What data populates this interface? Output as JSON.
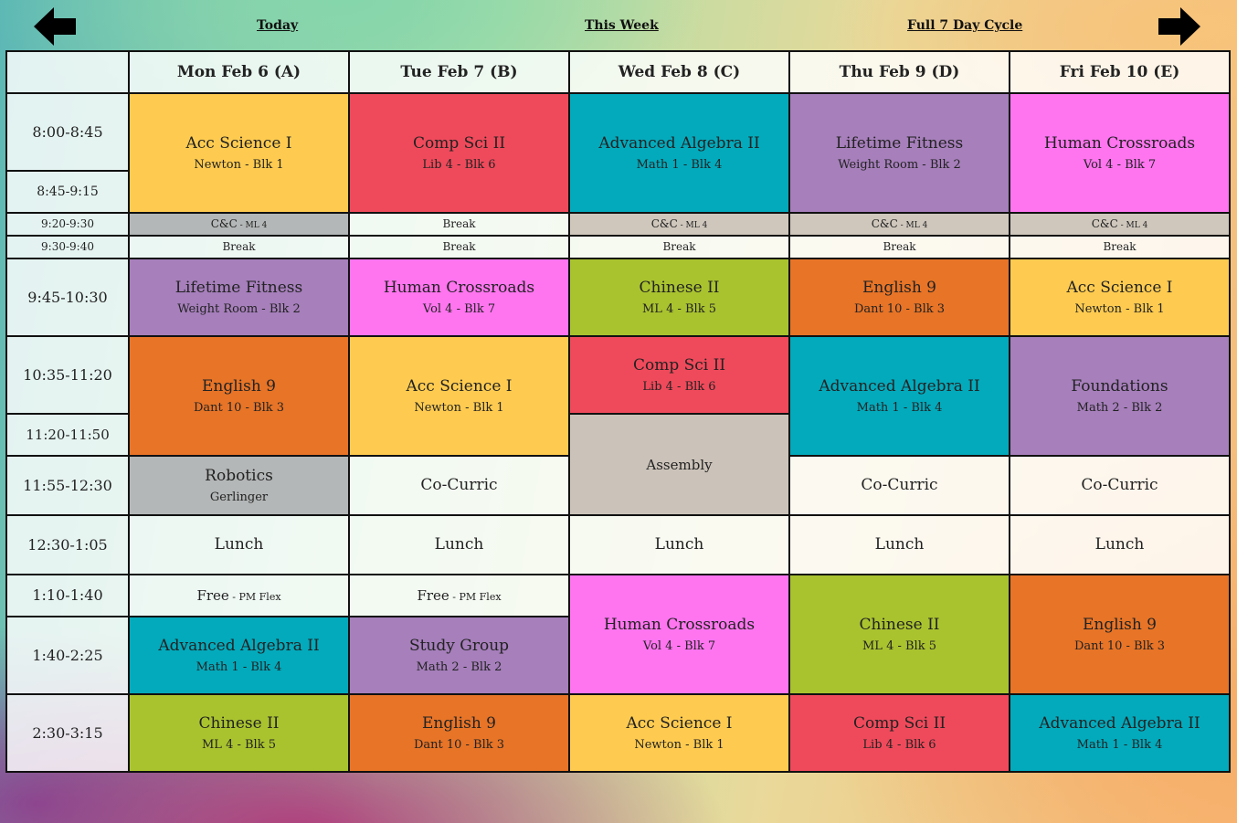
{
  "nav": {
    "prev_icon": "arrow-left-icon",
    "next_icon": "arrow-right-icon",
    "today": "Today",
    "this_week": "This Week",
    "full_cycle": "Full 7 Day Cycle"
  },
  "colors": {
    "acc_science": "#fecb50",
    "comp_sci": "#ef4a5b",
    "algebra": "#03aabc",
    "fitness": "#a67fbb",
    "crossroads": "#ff75f0",
    "chinese": "#a9c32f",
    "english": "#e77427",
    "robotics": "#b4b7b7",
    "assembly": "#cbc3b9"
  },
  "days": [
    "Mon Feb 6 (A)",
    "Tue Feb 7 (B)",
    "Wed Feb 8 (C)",
    "Thu Feb 9 (D)",
    "Fri Feb 10 (E)"
  ],
  "times": {
    "t800": "8:00-8:45",
    "t845": "8:45-9:15",
    "t920": "9:20-9:30",
    "t930": "9:30-9:40",
    "t945": "9:45-10:30",
    "t1035": "10:35-11:20",
    "t1120": "11:20-11:50",
    "t1155": "11:55-12:30",
    "t1230": "12:30-1:05",
    "t110": "1:10-1:40",
    "t140": "1:40-2:25",
    "t230": "2:30-3:15"
  },
  "schedule": {
    "mon": {
      "p1": {
        "name": "Acc Science I",
        "room": "Newton - Blk 1"
      },
      "cc": {
        "main": "C&C",
        "sub": " - ML 4"
      },
      "brk": "Break",
      "p2": {
        "name": "Lifetime Fitness",
        "room": "Weight Room - Blk 2"
      },
      "p3": {
        "name": "English 9",
        "room": "Dant 10 - Blk 3"
      },
      "p4": {
        "name": "Robotics",
        "room": "Gerlinger"
      },
      "lunch": "Lunch",
      "free": {
        "main": "Free",
        "sub": " - PM Flex"
      },
      "p5": {
        "name": "Advanced Algebra II",
        "room": "Math 1 - Blk 4"
      },
      "p6": {
        "name": "Chinese II",
        "room": "ML 4 - Blk 5"
      }
    },
    "tue": {
      "p1": {
        "name": "Comp Sci II",
        "room": "Lib 4 - Blk 6"
      },
      "brk1": "Break",
      "brk2": "Break",
      "p2": {
        "name": "Human Crossroads",
        "room": "Vol 4 - Blk 7"
      },
      "p3": {
        "name": "Acc Science I",
        "room": "Newton - Blk 1"
      },
      "cocurric": "Co-Curric",
      "lunch": "Lunch",
      "free": {
        "main": "Free",
        "sub": " - PM Flex"
      },
      "p5": {
        "name": "Study Group",
        "room": "Math 2 - Blk 2"
      },
      "p6": {
        "name": "English 9",
        "room": "Dant 10 - Blk 3"
      }
    },
    "wed": {
      "p1": {
        "name": "Advanced Algebra II",
        "room": "Math 1 - Blk 4"
      },
      "cc": {
        "main": "C&C",
        "sub": " - ML 4"
      },
      "brk": "Break",
      "p2": {
        "name": "Chinese II",
        "room": "ML 4 - Blk 5"
      },
      "p3": {
        "name": "Comp Sci II",
        "room": "Lib 4 - Blk 6"
      },
      "assembly": "Assembly",
      "lunch": "Lunch",
      "p5": {
        "name": "Human Crossroads",
        "room": "Vol 4 - Blk 7"
      },
      "p6": {
        "name": "Acc Science I",
        "room": "Newton - Blk 1"
      }
    },
    "thu": {
      "p1": {
        "name": "Lifetime Fitness",
        "room": "Weight Room - Blk 2"
      },
      "cc": {
        "main": "C&C",
        "sub": " - ML 4"
      },
      "brk": "Break",
      "p2": {
        "name": "English 9",
        "room": "Dant 10 - Blk 3"
      },
      "p3": {
        "name": "Advanced Algebra II",
        "room": "Math 1 - Blk 4"
      },
      "cocurric": "Co-Curric",
      "lunch": "Lunch",
      "p5": {
        "name": "Chinese II",
        "room": "ML 4 - Blk 5"
      },
      "p6": {
        "name": "Comp Sci II",
        "room": "Lib 4 - Blk 6"
      }
    },
    "fri": {
      "p1": {
        "name": "Human Crossroads",
        "room": "Vol 4 - Blk 7"
      },
      "cc": {
        "main": "C&C",
        "sub": " - ML 4"
      },
      "brk": "Break",
      "p2": {
        "name": "Acc Science I",
        "room": "Newton - Blk 1"
      },
      "p3": {
        "name": "Foundations",
        "room": "Math 2 - Blk 2"
      },
      "cocurric": "Co-Curric",
      "lunch": "Lunch",
      "p5": {
        "name": "English 9",
        "room": "Dant 10 - Blk 3"
      },
      "p6": {
        "name": "Advanced Algebra II",
        "room": "Math 1 - Blk 4"
      }
    }
  }
}
